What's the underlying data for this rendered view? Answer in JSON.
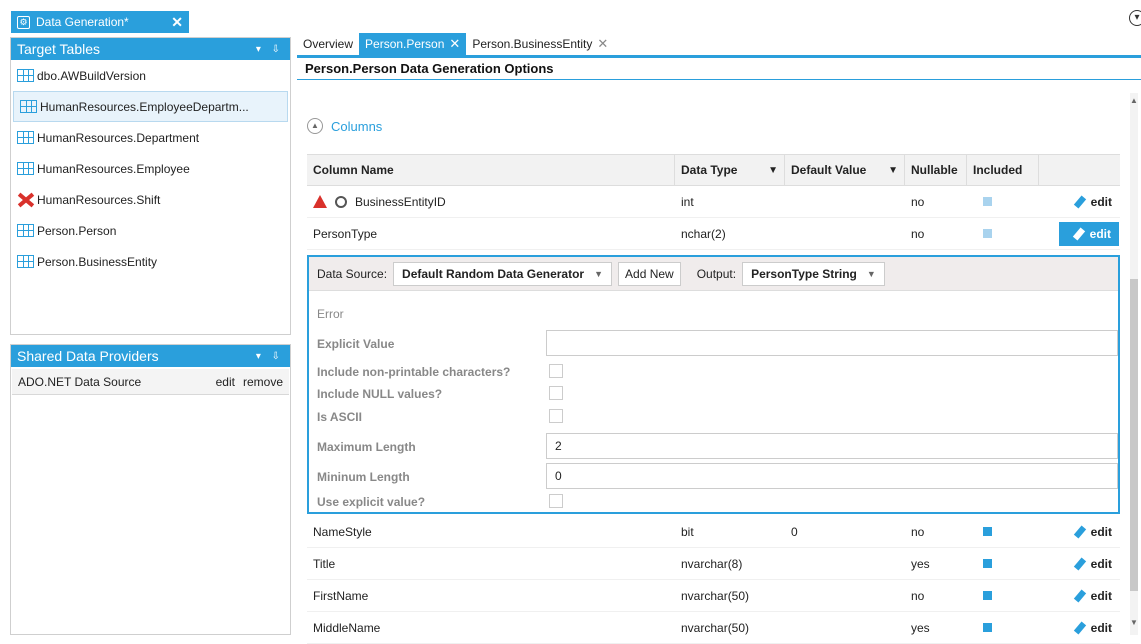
{
  "doc_tab": {
    "label": "Data Generation*",
    "close": "✕"
  },
  "target_tables": {
    "title": "Target Tables",
    "pin": "▾ ⇩",
    "items": [
      {
        "label": "dbo.AWBuildVersion",
        "state": "normal"
      },
      {
        "label": "HumanResources.EmployeeDepartm...",
        "state": "selected"
      },
      {
        "label": "HumanResources.Department",
        "state": "normal"
      },
      {
        "label": "HumanResources.Employee",
        "state": "normal"
      },
      {
        "label": "HumanResources.Shift",
        "state": "excluded"
      },
      {
        "label": "Person.Person",
        "state": "normal"
      },
      {
        "label": "Person.BusinessEntity",
        "state": "normal"
      }
    ]
  },
  "shared_providers": {
    "title": "Shared Data Providers",
    "pin": "▾ ⇩",
    "items": [
      {
        "label": "ADO.NET Data Source",
        "edit": "edit",
        "remove": "remove"
      }
    ]
  },
  "tabs": [
    {
      "label": "Overview",
      "active": false,
      "closable": false
    },
    {
      "label": "Person.Person",
      "active": true,
      "closable": true
    },
    {
      "label": "Person.BusinessEntity",
      "active": false,
      "closable": true
    }
  ],
  "options_title": "Person.Person Data Generation Options",
  "columns_label": "Columns",
  "grid": {
    "headers": {
      "name": "Column Name",
      "type": "Data Type",
      "default": "Default Value",
      "nullable": "Nullable",
      "included": "Included"
    },
    "edit_label": "edit",
    "rows_top": [
      {
        "name": "BusinessEntityID",
        "type": "int",
        "default": "",
        "nullable": "no",
        "included": "partial",
        "warn": true,
        "active": false
      },
      {
        "name": "PersonType",
        "type": "nchar(2)",
        "default": "",
        "nullable": "no",
        "included": "partial",
        "warn": false,
        "active": true
      }
    ],
    "rows_bottom": [
      {
        "name": "NameStyle",
        "type": "bit",
        "default": "0",
        "nullable": "no",
        "included": "yes"
      },
      {
        "name": "Title",
        "type": "nvarchar(8)",
        "default": "",
        "nullable": "yes",
        "included": "yes"
      },
      {
        "name": "FirstName",
        "type": "nvarchar(50)",
        "default": "",
        "nullable": "no",
        "included": "yes"
      },
      {
        "name": "MiddleName",
        "type": "nvarchar(50)",
        "default": "",
        "nullable": "yes",
        "included": "yes"
      }
    ]
  },
  "editor": {
    "data_source_label": "Data Source:",
    "data_source_value": "Default Random Data Generator",
    "add_new": "Add New",
    "output_label": "Output:",
    "output_value": "PersonType String",
    "error_label": "Error",
    "props": {
      "explicit_value": "Explicit Value",
      "include_nonprintable": "Include non-printable characters?",
      "include_null": "Include NULL values?",
      "is_ascii": "Is ASCII",
      "max_length": "Maximum Length",
      "max_length_value": "2",
      "min_length": "Mininum Length",
      "min_length_value": "0",
      "use_explicit": "Use explicit value?"
    }
  }
}
